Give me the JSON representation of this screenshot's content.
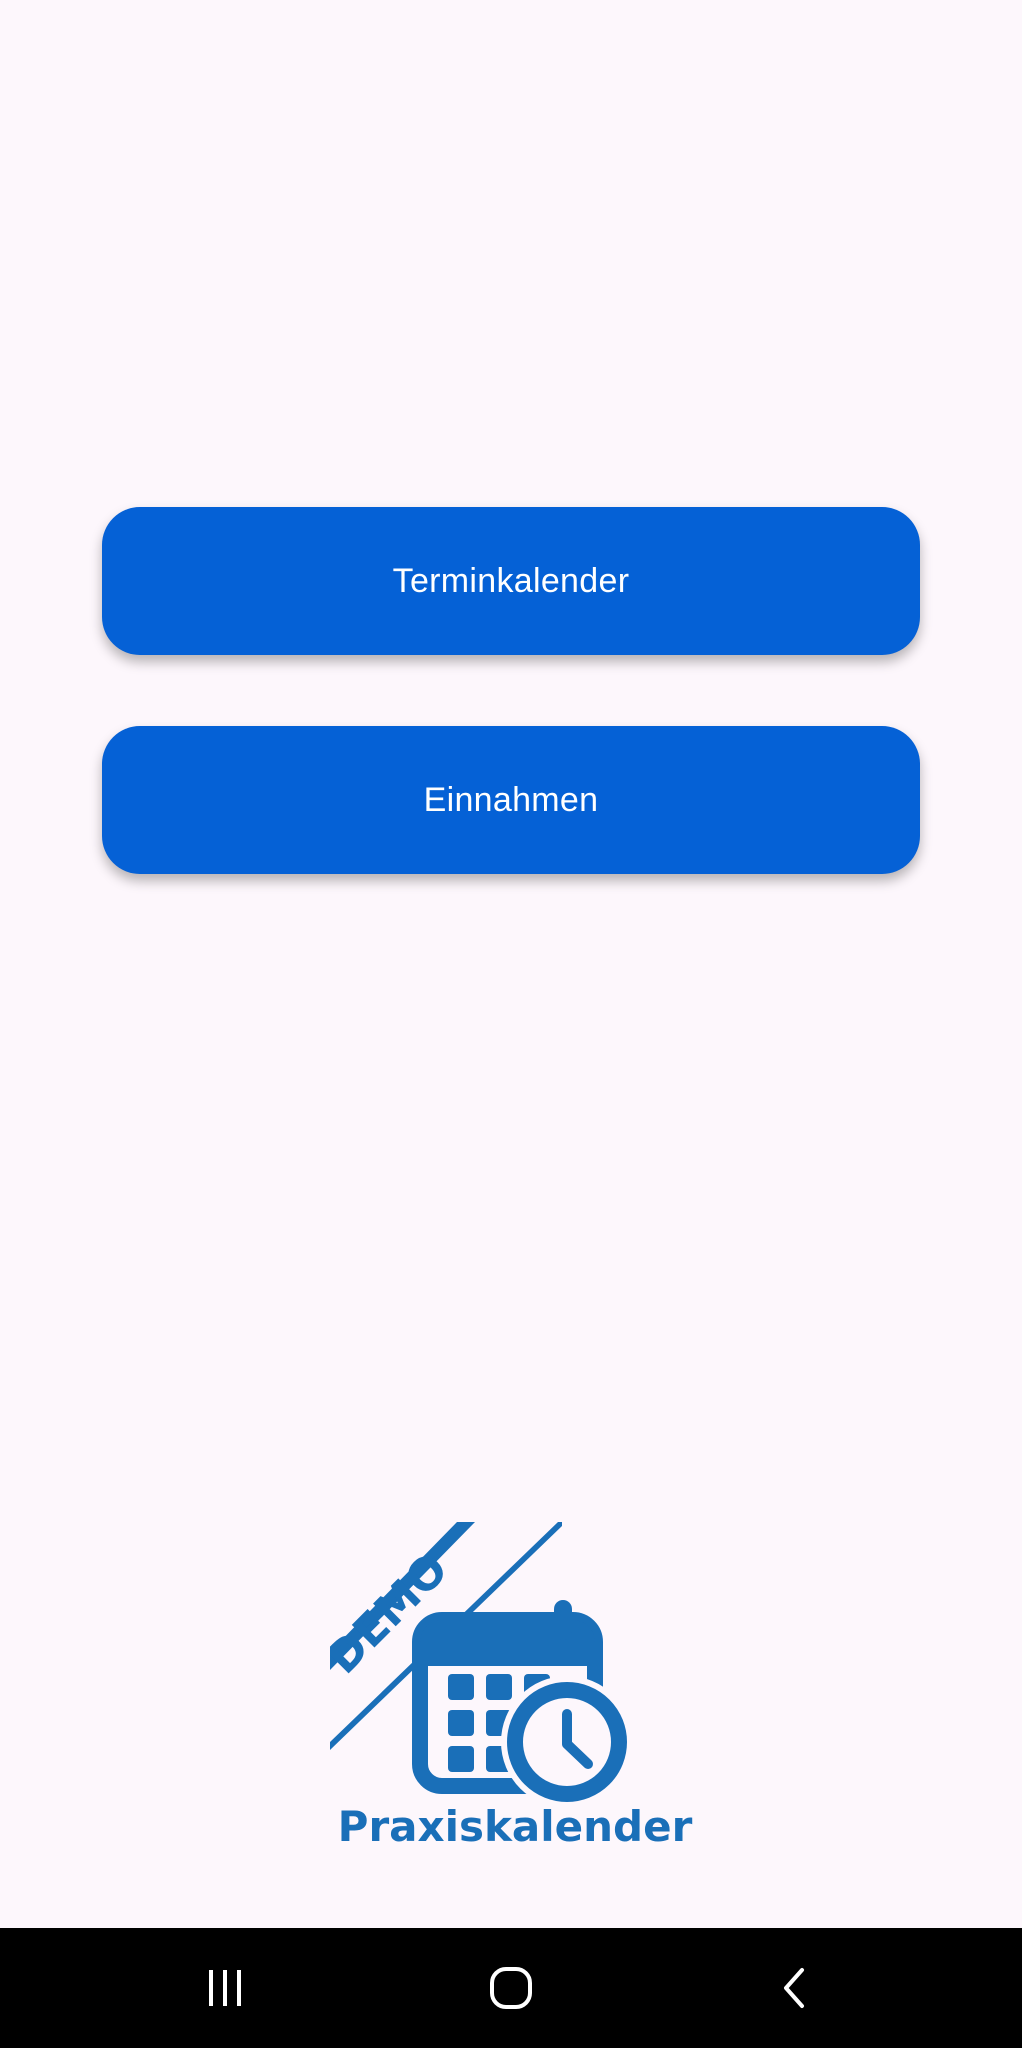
{
  "buttons": {
    "terminkalender": "Terminkalender",
    "einnahmen": "Einnahmen"
  },
  "logo": {
    "badge": "DEMO",
    "name": "Praxiskalender",
    "icon": "calendar-clock-icon",
    "color": "#1a6fb8"
  },
  "colors": {
    "background": "#fdf7fc",
    "button": "#0561d6",
    "button_text": "#ffffff",
    "nav_bar": "#000000"
  },
  "nav": {
    "recent_icon": "recent-apps-icon",
    "home_icon": "home-icon",
    "back_icon": "back-icon"
  }
}
